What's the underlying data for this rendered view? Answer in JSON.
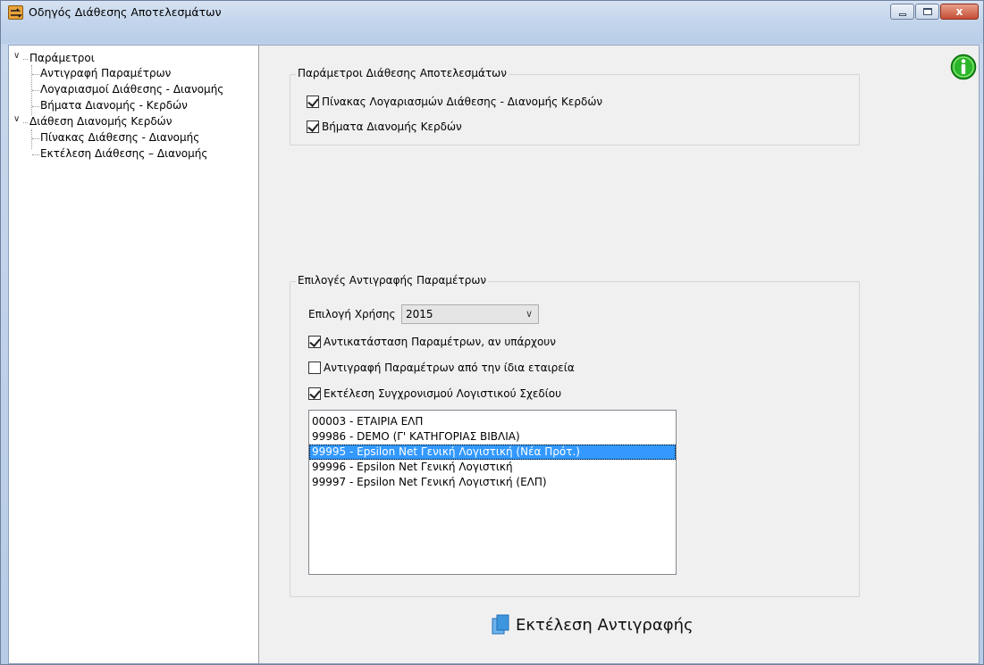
{
  "window": {
    "title": "Οδηγός Διάθεσης Αποτελεσμάτων",
    "close_label": "x"
  },
  "tree": {
    "nodes": [
      {
        "label": "Παράμετροι",
        "children": [
          "Αντιγραφή Παραμέτρων",
          "Λογαριασμοί Διάθεσης - Διανομής",
          "Βήματα Διανομής - Κερδών"
        ]
      },
      {
        "label": "Διάθεση Διανομής Κερδών",
        "children": [
          "Πίνακας Διάθεσης - Διανομής",
          "Εκτέλεση Διάθεσης – Διανομής"
        ]
      }
    ]
  },
  "params_group": {
    "title": "Παράμετροι Διάθεσης Αποτελεσμάτων",
    "options": [
      {
        "label": "Πίνακας Λογαριασμών Διάθεσης - Διανομής Κερδών",
        "checked": true
      },
      {
        "label": "Βήματα Διανομής Κερδών",
        "checked": true
      }
    ]
  },
  "copy_group": {
    "title": "Επιλογές Αντιγραφής Παραμέτρων",
    "year_label": "Επιλογή Χρήσης",
    "year_value": "2015",
    "options": [
      {
        "label": "Αντικατάσταση Παραμέτρων, αν υπάρχουν",
        "checked": true
      },
      {
        "label": "Αντιγραφή Παραμέτρων από την ίδια εταιρεία",
        "checked": false
      },
      {
        "label": "Εκτέλεση Συγχρονισμού Λογιστικού Σχεδίου",
        "checked": true
      }
    ],
    "companies": [
      {
        "label": "00003 - ΕΤΑΙΡΙΑ ΕΛΠ",
        "selected": false
      },
      {
        "label": "99986 - DEMO  (Γ' ΚΑΤΗΓΟΡΙΑΣ ΒΙΒΛΙΑ)",
        "selected": false
      },
      {
        "label": "99995 - Epsilon Net Γενική Λογιστική (Νέα Πρότ.)",
        "selected": true
      },
      {
        "label": "99996 - Epsilon Net Γενική Λογιστική",
        "selected": false
      },
      {
        "label": "99997 - Epsilon Net Γενική Λογιστική (ΕΛΠ)",
        "selected": false
      }
    ]
  },
  "run_button": {
    "label": "Εκτέλεση Αντιγραφής"
  },
  "icons": {
    "info": "info-icon",
    "copy": "copy-icon"
  },
  "colors": {
    "selection": "#3399ff",
    "info_green": "#2bb52b"
  }
}
